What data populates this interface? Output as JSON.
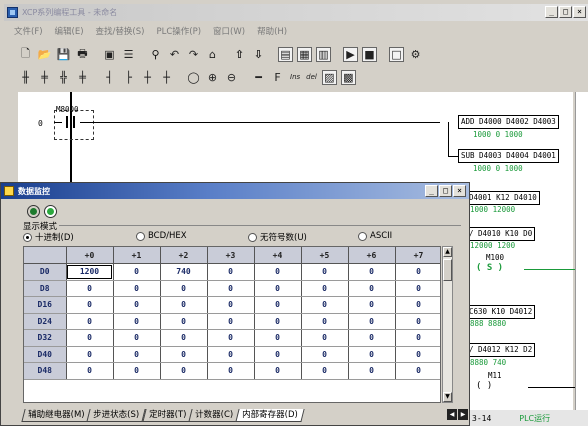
{
  "window": {
    "title": "XCP系列编程工具 - 未命名",
    "controls": [
      "_",
      "□",
      "×"
    ]
  },
  "menu": [
    {
      "id": "file",
      "label": "文件(F)"
    },
    {
      "id": "edit",
      "label": "编辑(E)"
    },
    {
      "id": "find",
      "label": "查找/替换(S)"
    },
    {
      "id": "plc",
      "label": "PLC操作(P)"
    },
    {
      "id": "window",
      "label": "窗口(W)"
    },
    {
      "id": "help",
      "label": "帮助(H)"
    }
  ],
  "toolbar2_text": {
    "ins": "Ins",
    "del": "del"
  },
  "ladder": {
    "rung_number": "0",
    "contact": "M8000",
    "instructions": [
      {
        "text": "ADD D4000 D4002 D4003",
        "values": "1000 0 1000"
      },
      {
        "text": "SUB D4003 D4004 D4001",
        "values": "1000 0 1000"
      },
      {
        "text": "D4001 K12 D4010",
        "values": "1000    12000"
      },
      {
        "text": "/ D4010 K10 D0",
        "values": "12000   1200"
      },
      {
        "text": "C630 K10 D4012",
        "values": "888    8880"
      },
      {
        "text": "/ D4012 K12 D2",
        "values": "8880   740"
      }
    ],
    "coils": [
      {
        "label": "M100",
        "symbol": "( S )"
      },
      {
        "label": "M11",
        "symbol": "(    )"
      }
    ]
  },
  "status": {
    "step": "3-14",
    "run": "PLC运行"
  },
  "monitor": {
    "title": "数据监控",
    "controls": [
      "_",
      "□",
      "×"
    ],
    "display_group": "显示模式",
    "radios": [
      {
        "label": "十进制(D)",
        "checked": true
      },
      {
        "label": "BCD/HEX",
        "checked": false
      },
      {
        "label": "无符号数(U)",
        "checked": false
      },
      {
        "label": "ASCII",
        "checked": false
      }
    ],
    "columns": [
      "",
      "+0",
      "+1",
      "+2",
      "+3",
      "+4",
      "+5",
      "+6",
      "+7"
    ],
    "rows": [
      {
        "addr": "D0",
        "values": [
          "1200",
          "0",
          "740",
          "0",
          "0",
          "0",
          "0",
          "0"
        ]
      },
      {
        "addr": "D8",
        "values": [
          "0",
          "0",
          "0",
          "0",
          "0",
          "0",
          "0",
          "0"
        ]
      },
      {
        "addr": "D16",
        "values": [
          "0",
          "0",
          "0",
          "0",
          "0",
          "0",
          "0",
          "0"
        ]
      },
      {
        "addr": "D24",
        "values": [
          "0",
          "0",
          "0",
          "0",
          "0",
          "0",
          "0",
          "0"
        ]
      },
      {
        "addr": "D32",
        "values": [
          "0",
          "0",
          "0",
          "0",
          "0",
          "0",
          "0",
          "0"
        ]
      },
      {
        "addr": "D40",
        "values": [
          "0",
          "0",
          "0",
          "0",
          "0",
          "0",
          "0",
          "0"
        ]
      },
      {
        "addr": "D48",
        "values": [
          "0",
          "0",
          "0",
          "0",
          "0",
          "0",
          "0",
          "0"
        ]
      }
    ],
    "tabs": [
      {
        "label": "辅助继电器(M)",
        "active": false
      },
      {
        "label": "步进状态(S)",
        "active": false
      },
      {
        "label": "定时器(T)",
        "active": false
      },
      {
        "label": "计数器(C)",
        "active": false
      },
      {
        "label": "内部寄存器(D)",
        "active": true
      }
    ]
  }
}
